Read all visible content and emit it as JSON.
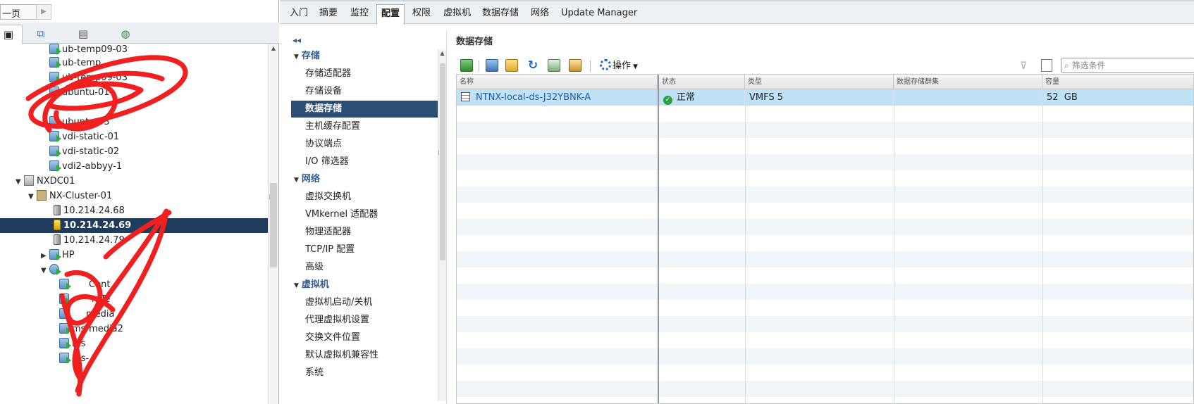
{
  "history": {
    "label": "一页"
  },
  "tree": {
    "tab_icons": [
      "hosts-clusters-icon",
      "vms-templates-icon",
      "storage-icon",
      "network-icon"
    ],
    "nodes": [
      {
        "label": "ub-temp09-03",
        "icon": "vm-icon"
      },
      {
        "label": "ub-temp",
        "icon": "vm-icon"
      },
      {
        "label": "ub-temp09-03",
        "icon": "vm-icon"
      },
      {
        "label": "ubuntu-01",
        "icon": "vm-icon"
      },
      {
        "label": "ubuntu-03",
        "icon": "vm-icon"
      },
      {
        "label": "vdi-static-01",
        "icon": "vm-icon"
      },
      {
        "label": "vdi-static-02",
        "icon": "vm-icon"
      },
      {
        "label": "vdi2-abbyy-1",
        "icon": "vm-icon"
      },
      {
        "label": "NXDC01",
        "icon": "datacenter-icon"
      },
      {
        "label": "NX-Cluster-01",
        "icon": "cluster-icon"
      },
      {
        "label": "10.214.24.68",
        "icon": "host-icon"
      },
      {
        "label": "10.214.24.69",
        "icon": "host-warning-icon"
      },
      {
        "label": "10.214.24.79",
        "icon": "host-icon"
      },
      {
        "label": "HP",
        "icon": "vm-icon"
      },
      {
        "label": "",
        "icon": "resource-pool-icon"
      },
      {
        "label": "Cent",
        "icon": "vm-icon"
      },
      {
        "label": "mTe",
        "icon": "vm-icon"
      },
      {
        "label": "media",
        "icon": "vm-icon"
      },
      {
        "label": "ms-media2",
        "icon": "vm-icon"
      },
      {
        "label": "ms",
        "icon": "vm-icon"
      },
      {
        "label": "ms-",
        "icon": "vm-icon"
      }
    ]
  },
  "tabs": [
    "入门",
    "摘要",
    "监控",
    "配置",
    "权限",
    "虚拟机",
    "数据存储",
    "网络",
    "Update Manager"
  ],
  "subnav": {
    "groups": [
      {
        "label": "存储",
        "items": [
          "存储适配器",
          "存储设备",
          "数据存储",
          "主机缓存配置",
          "协议端点",
          "I/O 筛选器"
        ]
      },
      {
        "label": "网络",
        "items": [
          "虚拟交换机",
          "VMkernel 适配器",
          "物理适配器",
          "TCP/IP 配置",
          "高级"
        ]
      },
      {
        "label": "虚拟机",
        "items": [
          "虚拟机启动/关机",
          "代理虚拟机设置",
          "交换文件位置",
          "默认虚拟机兼容性",
          "系统"
        ]
      }
    ],
    "selected": "数据存储"
  },
  "content": {
    "title": "数据存储",
    "toolbar": {
      "actions_label": "操作",
      "filter_placeholder": "筛选条件",
      "icons": [
        "new-datastore-icon",
        "register-vm-icon",
        "browse-files-icon",
        "refresh-icon",
        "increase-capacity-icon",
        "settings-icon"
      ]
    },
    "columns": [
      "名称",
      "状态",
      "类型",
      "数据存储群集",
      "容量"
    ],
    "rows": [
      {
        "name": "NTNX-local-ds-J32YBNK-A",
        "status": "正常",
        "type": "VMFS 5",
        "cluster": "",
        "capacity": "52  GB"
      }
    ]
  },
  "colors": {
    "selection": "#1f3c5c",
    "row_selected": "#bfe2f7",
    "link": "#2a5aa6",
    "ok": "#2ea043",
    "scribble": "#f02020"
  }
}
